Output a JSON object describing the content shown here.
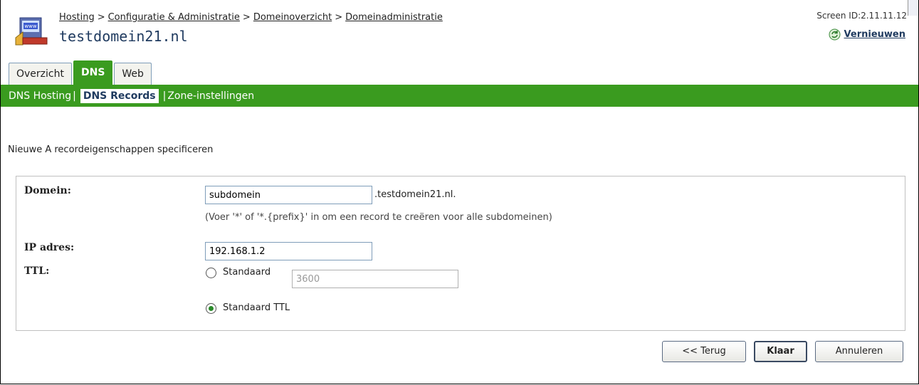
{
  "breadcrumb": {
    "items": [
      "Hosting",
      "Configuratie & Administratie",
      "Domeinoverzicht",
      "Domeinadministratie"
    ],
    "separator": ">"
  },
  "page_title": "testdomein21.nl",
  "screen_id": "Screen ID:2.11.11.12",
  "refresh_label": "Vernieuwen",
  "tabs": [
    {
      "label": "Overzicht",
      "active": false
    },
    {
      "label": "DNS",
      "active": true
    },
    {
      "label": "Web",
      "active": false
    }
  ],
  "subnav": {
    "items": [
      "DNS Hosting",
      "DNS Records",
      "Zone-instellingen"
    ],
    "separator": "|"
  },
  "intro": "Nieuwe A recordeigenschappen specificeren",
  "form": {
    "domain_label": "Domein:",
    "domain_value": "subdomein",
    "domain_suffix": ".testdomein21.nl.",
    "domain_hint": "(Voer '*' of '*.{prefix}' in om een record te creëren voor alle subdomeinen)",
    "ip_label": "IP adres:",
    "ip_value": "192.168.1.2",
    "ttl_label": "TTL:",
    "ttl_option_custom": "Standaard",
    "ttl_custom_value": "3600",
    "ttl_option_default": "Standaard TTL",
    "ttl_selected": "Standaard TTL"
  },
  "buttons": {
    "back": "<< Terug",
    "done": "Klaar",
    "cancel": "Annuleren"
  },
  "colors": {
    "accent_green": "#3a9b1f",
    "title_blue": "#1f3a5f"
  },
  "icons": [
    "domain-logo-icon",
    "refresh-icon"
  ]
}
